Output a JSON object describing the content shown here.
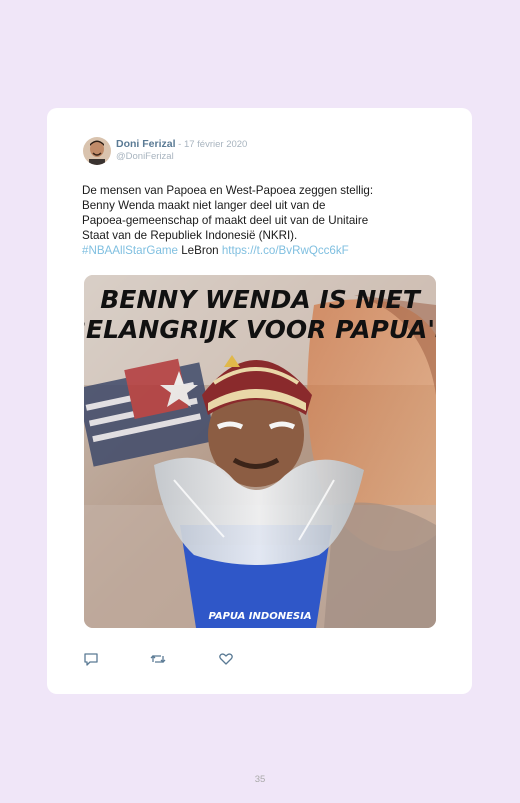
{
  "tweet": {
    "author_name": "Doni Ferizal",
    "date": " - 17 février 2020",
    "handle": "@DoniFerizal",
    "text_lines": [
      "De mensen van Papoea en West-Papoea zeggen stellig:",
      "Benny Wenda maakt niet langer deel uit van de",
      "Papoea-gemeenschap of maakt deel uit van de Unitaire",
      "Staat van de Republiek Indonesië (NKRI)."
    ],
    "hashtag": "#NBAAllStarGame",
    "after_hashtag": " LeBron ",
    "link": "https://t.co/BvRwQcc6kF",
    "media": {
      "headline_line1": "BENNY WENDA IS NIET",
      "headline_line2": "BELANGRIJK VOOR PAPUA'S",
      "watermark": "PAPUA INDONESIA"
    },
    "actions": [
      {
        "icon": "reply-icon"
      },
      {
        "icon": "retweet-icon"
      },
      {
        "icon": "like-icon"
      }
    ]
  },
  "page_number": "35"
}
